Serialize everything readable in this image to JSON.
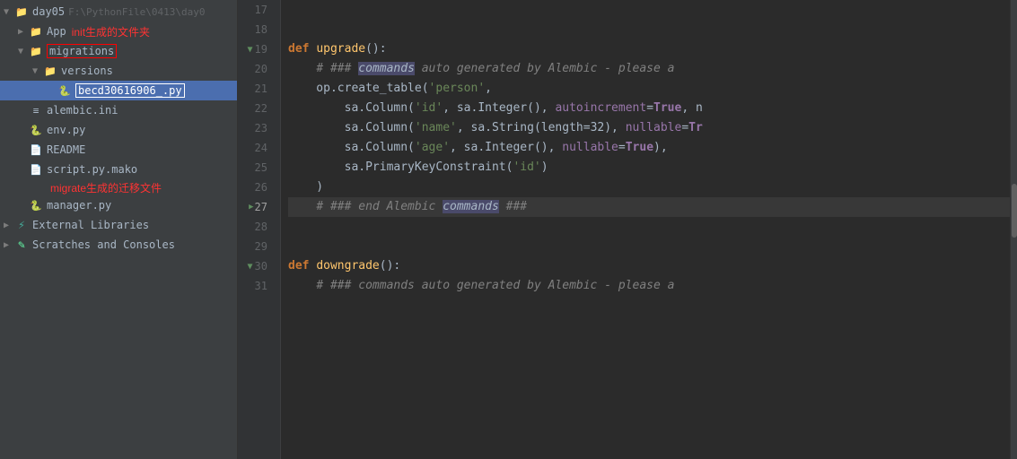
{
  "sidebar": {
    "title": "day05",
    "path": "F:\\PythonFile\\0413\\day0",
    "items": [
      {
        "id": "day05",
        "label": "day05",
        "indent": 0,
        "type": "root",
        "arrow": "▼",
        "icon": "folder"
      },
      {
        "id": "app",
        "label": "App",
        "indent": 1,
        "type": "folder",
        "arrow": "▶",
        "icon": "folder",
        "annotation": "init生成的文件夹"
      },
      {
        "id": "migrations",
        "label": "migrations",
        "indent": 1,
        "type": "folder",
        "arrow": "▼",
        "icon": "folder",
        "boxed": true
      },
      {
        "id": "versions",
        "label": "versions",
        "indent": 2,
        "type": "folder",
        "arrow": "▼",
        "icon": "folder"
      },
      {
        "id": "becd",
        "label": "becd30616906_.py",
        "indent": 3,
        "type": "pyfile",
        "boxed": true,
        "selected": true
      },
      {
        "id": "alembic",
        "label": "alembic.ini",
        "indent": 1,
        "type": "inifile"
      },
      {
        "id": "env",
        "label": "env.py",
        "indent": 1,
        "type": "pyfile"
      },
      {
        "id": "readme",
        "label": "README",
        "indent": 1,
        "type": "file"
      },
      {
        "id": "script",
        "label": "script.py.mako",
        "indent": 1,
        "type": "makofile",
        "annotation": "migrate生成的迁移文件"
      },
      {
        "id": "manager",
        "label": "manager.py",
        "indent": 1,
        "type": "pyfile"
      },
      {
        "id": "ext-libs",
        "label": "External Libraries",
        "indent": 0,
        "type": "special"
      },
      {
        "id": "scratches",
        "label": "Scratches and Consoles",
        "indent": 0,
        "type": "special"
      }
    ]
  },
  "editor": {
    "lines": [
      {
        "num": 17,
        "content": ""
      },
      {
        "num": 18,
        "content": ""
      },
      {
        "num": 19,
        "content": "def upgrade():",
        "arrow": false
      },
      {
        "num": 20,
        "content": "    # ### commands auto generated by Alembic - please a",
        "arrow": false
      },
      {
        "num": 21,
        "content": "    op.create_table('person',",
        "arrow": false
      },
      {
        "num": 22,
        "content": "        sa.Column('id', sa.Integer(), autoincrement=True, n",
        "arrow": false
      },
      {
        "num": 23,
        "content": "        sa.Column('name', sa.String(length=32), nullable=Tr",
        "arrow": false
      },
      {
        "num": 24,
        "content": "        sa.Column('age', sa.Integer(), nullable=True),",
        "arrow": false
      },
      {
        "num": 25,
        "content": "        sa.PrimaryKeyConstraint('id')",
        "arrow": false
      },
      {
        "num": 26,
        "content": "    )",
        "arrow": false
      },
      {
        "num": 27,
        "content": "    # ### end Alembic commands ###",
        "arrow": true
      },
      {
        "num": 28,
        "content": ""
      },
      {
        "num": 29,
        "content": ""
      },
      {
        "num": 30,
        "content": "def downgrade():",
        "arrow": false
      },
      {
        "num": 31,
        "content": "    # ### commands auto generated by Alembic - please a",
        "arrow": false
      }
    ]
  }
}
